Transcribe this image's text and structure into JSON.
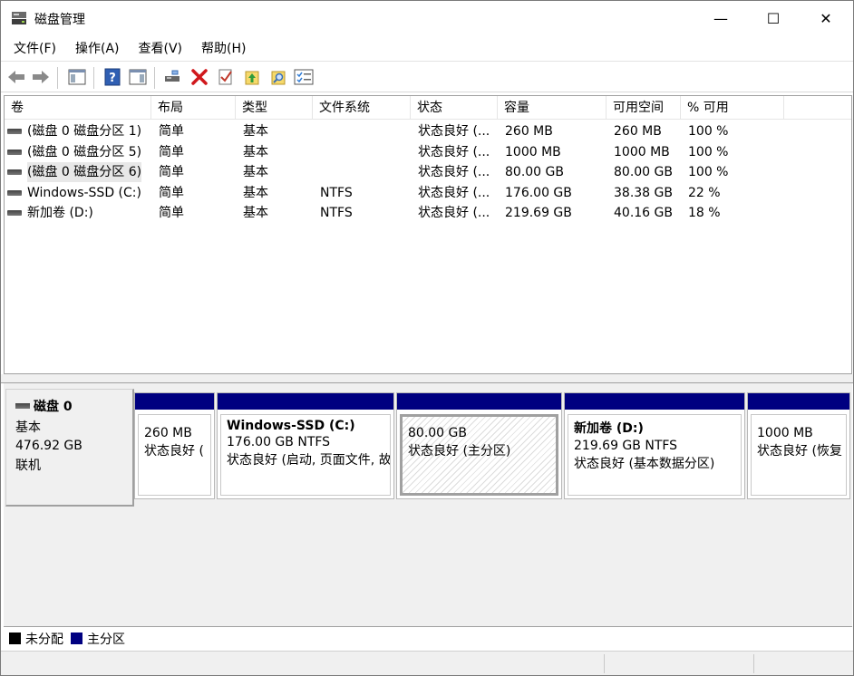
{
  "window": {
    "title": "磁盘管理",
    "minimize_glyph": "—",
    "maximize_glyph": "☐",
    "close_glyph": "✕"
  },
  "menu": [
    "文件(F)",
    "操作(A)",
    "查看(V)",
    "帮助(H)"
  ],
  "toolbar": {
    "icons": [
      "back-arrow-icon",
      "forward-arrow-icon",
      "show-hide-console-tree-icon",
      "help-icon",
      "show-action-pane-icon",
      "connect-drive-icon",
      "delete-icon",
      "check-icon",
      "up-folder-icon",
      "search-folder-icon",
      "properties-list-icon"
    ]
  },
  "volume_list": {
    "columns": [
      "卷",
      "布局",
      "类型",
      "文件系统",
      "状态",
      "容量",
      "可用空间",
      "% 可用"
    ],
    "rows": [
      [
        "(磁盘 0 磁盘分区 1)",
        "简单",
        "基本",
        "",
        "状态良好 (...",
        "260 MB",
        "260 MB",
        "100 %"
      ],
      [
        "(磁盘 0 磁盘分区 5)",
        "简单",
        "基本",
        "",
        "状态良好 (...",
        "1000 MB",
        "1000 MB",
        "100 %"
      ],
      [
        "(磁盘 0 磁盘分区 6)",
        "简单",
        "基本",
        "",
        "状态良好 (...",
        "80.00 GB",
        "80.00 GB",
        "100 %"
      ],
      [
        "Windows-SSD (C:)",
        "简单",
        "基本",
        "NTFS",
        "状态良好 (...",
        "176.00 GB",
        "38.38 GB",
        "22 %"
      ],
      [
        "新加卷 (D:)",
        "简单",
        "基本",
        "NTFS",
        "状态良好 (...",
        "219.69 GB",
        "40.16 GB",
        "18 %"
      ]
    ],
    "selected_row": 2
  },
  "disk": {
    "name": "磁盘 0",
    "type": "基本",
    "size": "476.92 GB",
    "status": "联机",
    "partitions": [
      {
        "name": "",
        "size": "260 MB",
        "status": "状态良好 ("
      },
      {
        "name": "Windows-SSD  (C:)",
        "size": "176.00 GB NTFS",
        "status": "状态良好 (启动, 页面文件, 故"
      },
      {
        "name": "",
        "size": "80.00 GB",
        "status": "状态良好 (主分区)"
      },
      {
        "name": "新加卷  (D:)",
        "size": "219.69 GB NTFS",
        "status": "状态良好 (基本数据分区)"
      },
      {
        "name": "",
        "size": "1000 MB",
        "status": "状态良好 (恢复"
      }
    ]
  },
  "legend": [
    {
      "label": "未分配",
      "color": "#000000"
    },
    {
      "label": "主分区",
      "color": "#000080"
    }
  ]
}
